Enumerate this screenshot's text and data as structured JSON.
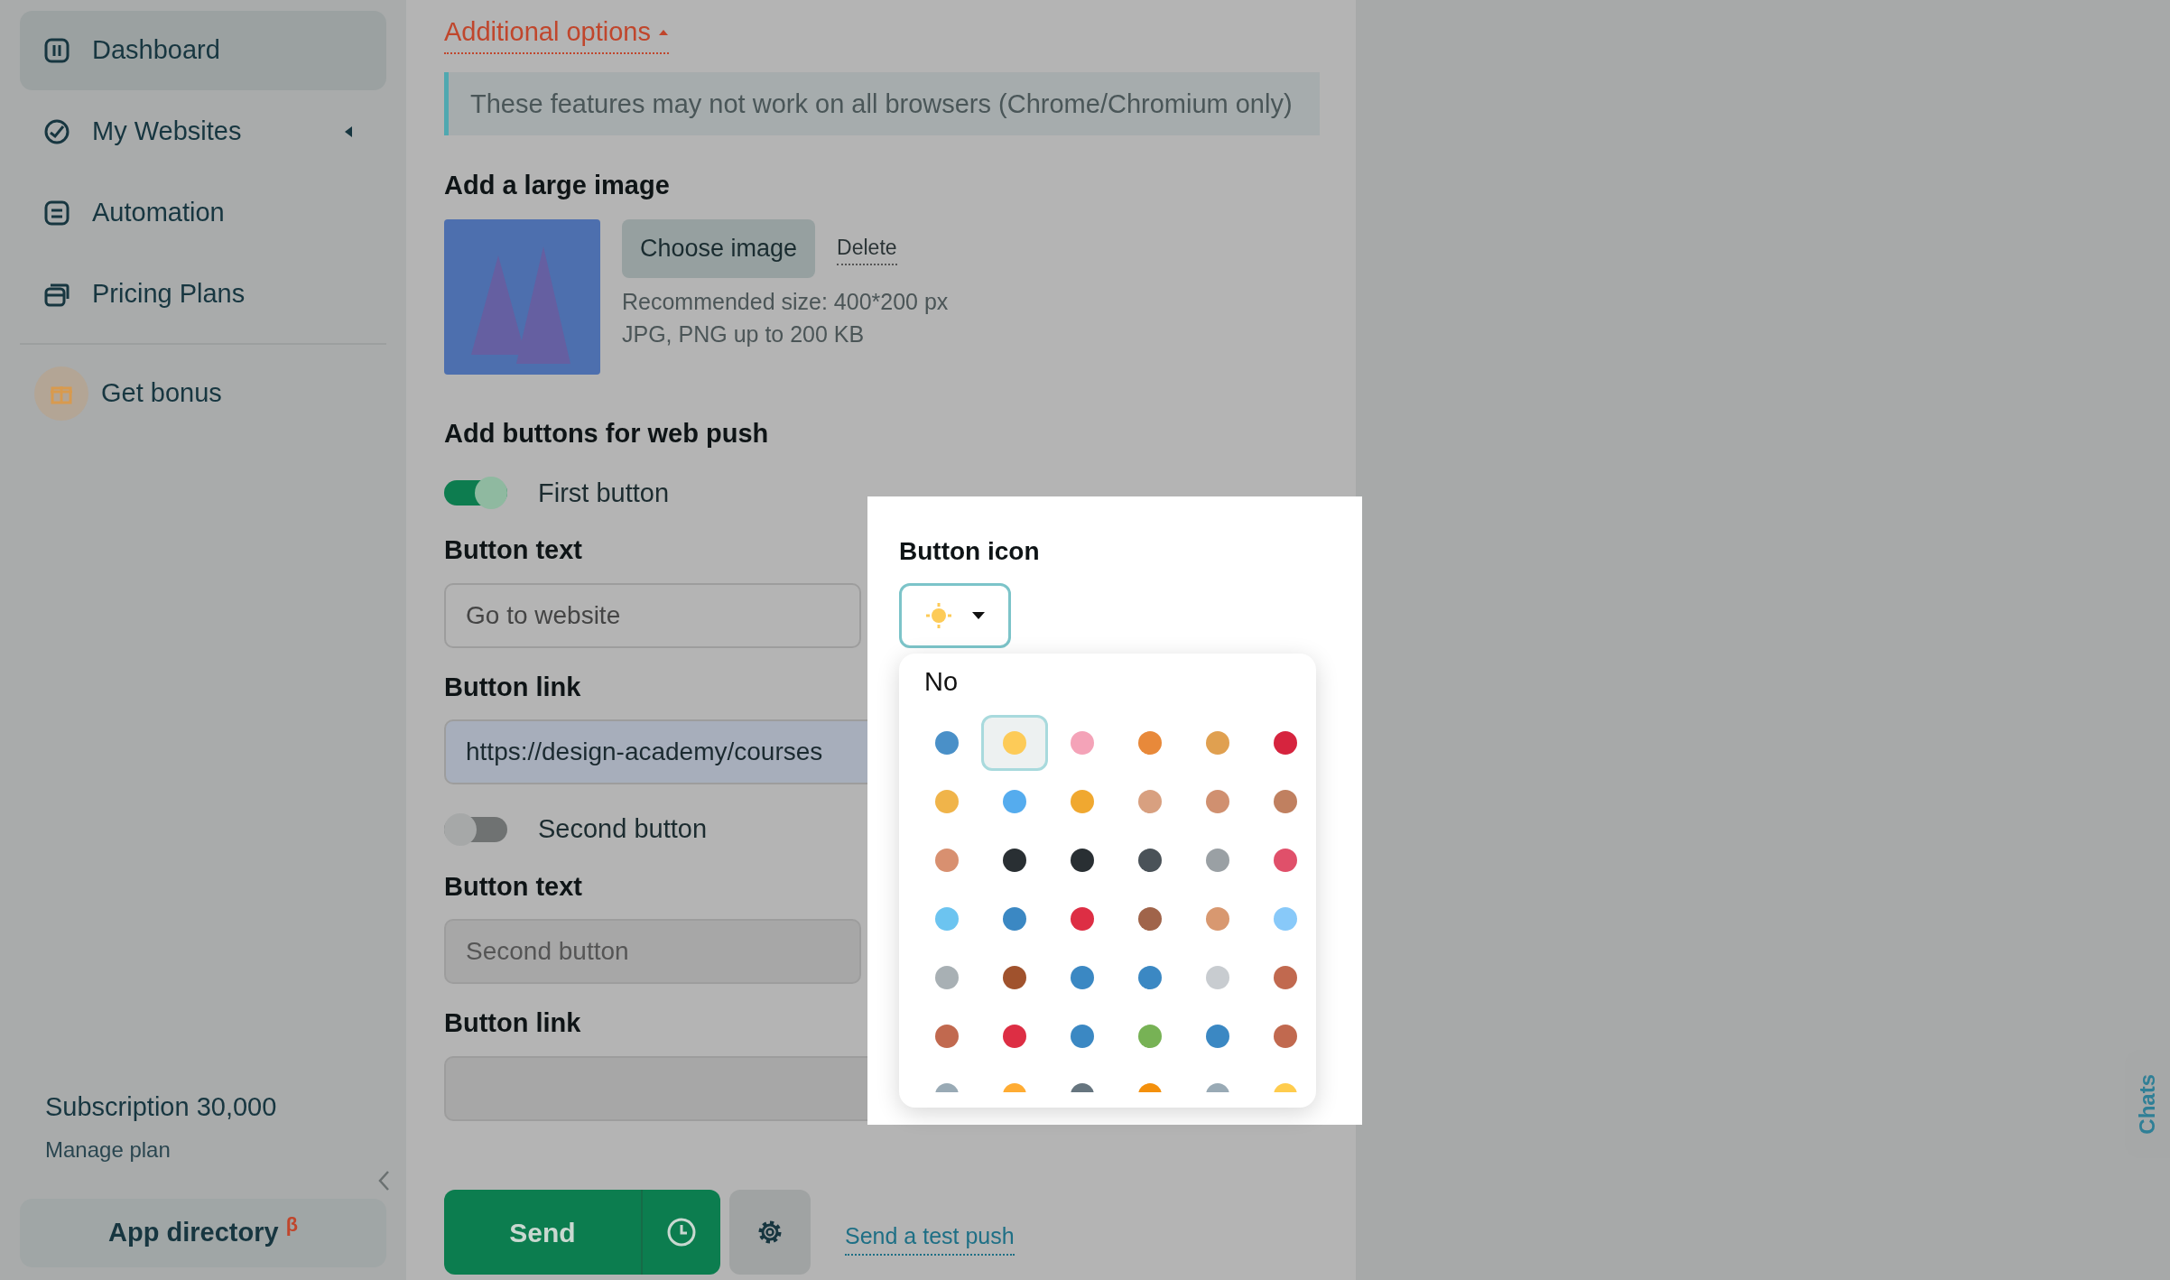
{
  "sidebar": {
    "items": [
      {
        "label": "Dashboard",
        "selected": true,
        "has_submenu": false
      },
      {
        "label": "My Websites",
        "selected": false,
        "has_submenu": true
      },
      {
        "label": "Automation",
        "selected": false,
        "has_submenu": false
      },
      {
        "label": "Pricing Plans",
        "selected": false,
        "has_submenu": false
      }
    ],
    "bonus": "Get bonus",
    "subscription": "Subscription 30,000",
    "manage_plan": "Manage plan",
    "app_directory": "App directory",
    "app_directory_mark": "β"
  },
  "additional_options": {
    "label": "Additional options",
    "expanded": true
  },
  "note": "These features may not work on all browsers (Chrome/Chromium only)",
  "large_image": {
    "title": "Add a large image",
    "choose": "Choose image",
    "delete": "Delete",
    "hints": [
      "Recommended size: 400*200 px",
      "JPG, PNG up to 200 KB"
    ]
  },
  "buttons_title": "Add buttons for web push",
  "push_buttons": [
    {
      "toggle_label": "First button",
      "on": true,
      "disabled": false,
      "text_label": "Button text",
      "text_value": "Go to website",
      "link_label": "Button link",
      "link_value": "https://design-academy/courses"
    },
    {
      "toggle_label": "Second button",
      "on": false,
      "disabled": true,
      "text_label": "Button text",
      "text_placeholder": "Second button",
      "link_label": "Button link"
    }
  ],
  "footer": {
    "send": "Send",
    "test_push": "Send a test push"
  },
  "icon_popup": {
    "title": "Button icon",
    "none_option": "No",
    "icons": [
      {
        "selected": false
      },
      {
        "selected": true
      },
      {
        "selected": false
      },
      {
        "selected": false
      },
      {
        "selected": false
      },
      {
        "selected": false
      },
      {
        "selected": false
      },
      {
        "selected": false
      },
      {
        "selected": false
      },
      {
        "selected": false
      },
      {
        "selected": false
      },
      {
        "selected": false
      },
      {
        "selected": false
      },
      {
        "selected": false
      },
      {
        "selected": false
      },
      {
        "selected": false
      },
      {
        "selected": false
      },
      {
        "selected": false
      },
      {
        "selected": false
      },
      {
        "selected": false
      },
      {
        "selected": false
      },
      {
        "selected": false
      },
      {
        "selected": false
      },
      {
        "selected": false
      },
      {
        "selected": false
      },
      {
        "selected": false
      },
      {
        "selected": false
      },
      {
        "selected": false
      },
      {
        "selected": false
      },
      {
        "selected": false
      },
      {
        "selected": false
      },
      {
        "selected": false
      },
      {
        "selected": false
      },
      {
        "selected": false
      },
      {
        "selected": false
      },
      {
        "selected": false
      },
      {
        "selected": false
      },
      {
        "selected": false
      },
      {
        "selected": false
      },
      {
        "selected": false
      },
      {
        "selected": false
      },
      {
        "selected": false
      }
    ]
  },
  "chats": "Chats"
}
